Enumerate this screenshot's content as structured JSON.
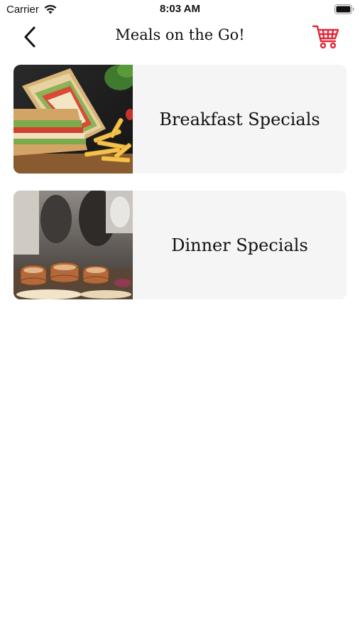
{
  "status_bar": {
    "carrier": "Carrier",
    "time": "8:03 AM"
  },
  "nav": {
    "title": "Meals on the Go!",
    "back_icon": "chevron-left-icon",
    "cart_icon": "shopping-cart-icon",
    "accent_color": "#e0283a"
  },
  "menu": {
    "items": [
      {
        "label": "Breakfast Specials",
        "image": "club sandwich with fries"
      },
      {
        "label": "Dinner Specials",
        "image": "restaurant buffet with copper serving dishes"
      }
    ]
  }
}
